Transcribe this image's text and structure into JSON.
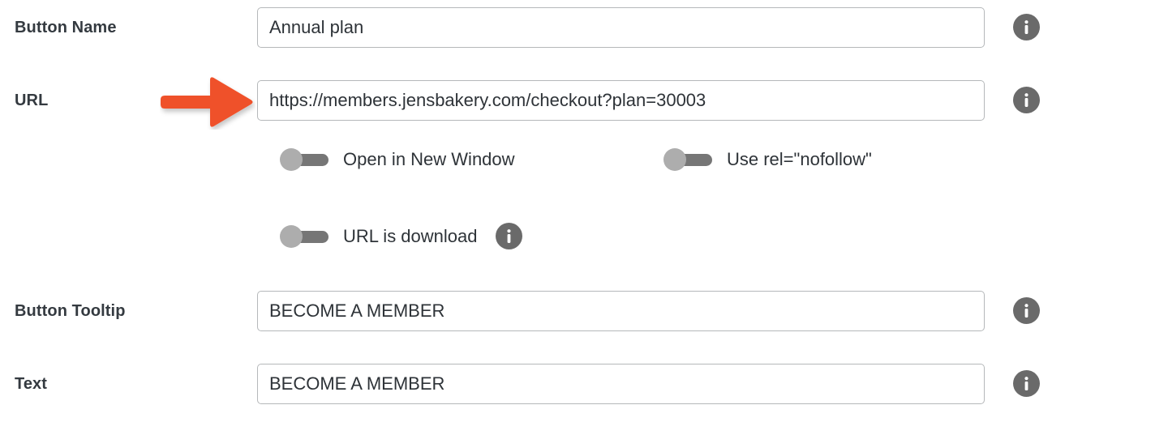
{
  "colors": {
    "annotation_arrow": "#ef5129",
    "info_icon": "#6a6a6a",
    "toggle_knob": "#adadad",
    "toggle_track": "#767676",
    "label_text": "#343a40",
    "field_border": "#b5b8ba",
    "background": "#ffffff"
  },
  "form": {
    "fields": [
      {
        "label": "Button Name",
        "value": "Annual plan",
        "placeholder": "Button Name",
        "info_icon": "info-icon"
      },
      {
        "label": "URL",
        "value": "https://members.jensbakery.com/checkout?plan=30003",
        "placeholder": "URL",
        "info_icon": "info-icon"
      },
      {
        "label": "Button Tooltip",
        "value": "BECOME A MEMBER",
        "placeholder": "Button Tooltip",
        "info_icon": "info-icon"
      },
      {
        "label": "Text",
        "value": "BECOME A MEMBER",
        "placeholder": "Text",
        "info_icon": "info-icon"
      }
    ],
    "toggles": [
      {
        "label": "Open in New Window",
        "state": "off",
        "has_info": false
      },
      {
        "label": "Use rel=\"nofollow\"",
        "state": "off",
        "has_info": false
      },
      {
        "label": "URL is download",
        "state": "off",
        "has_info": true,
        "info_icon": "info-icon"
      }
    ]
  },
  "annotation": {
    "type": "arrow",
    "direction": "right",
    "points_at": "URL",
    "color": "#ef5129"
  }
}
